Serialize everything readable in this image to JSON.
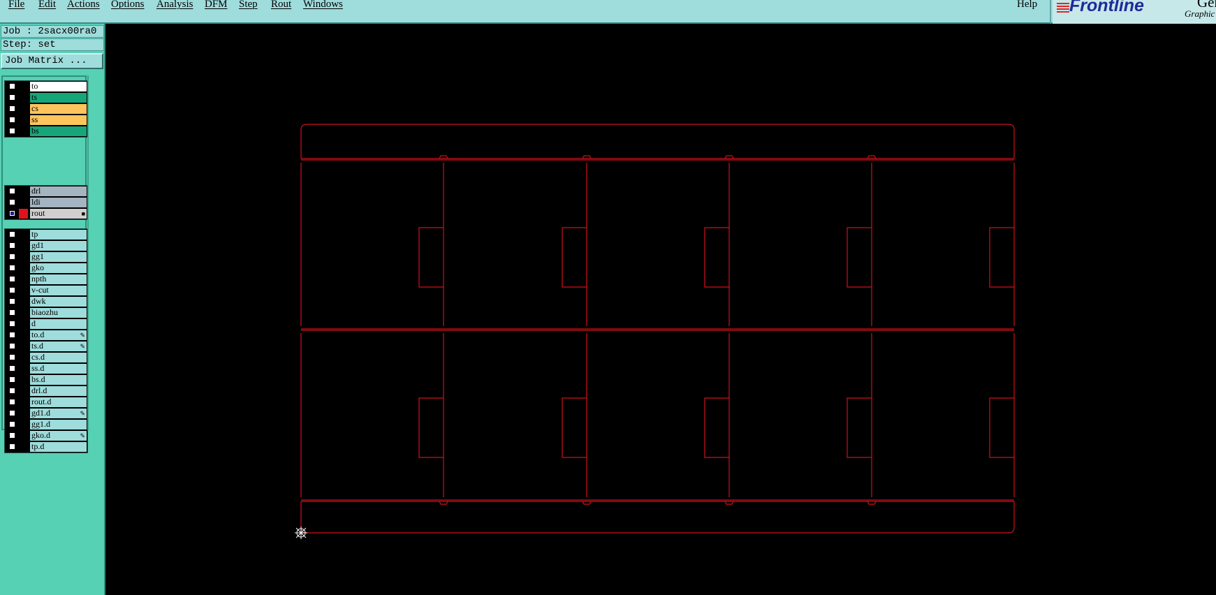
{
  "menubar": {
    "items": [
      "File",
      "Edit",
      "Actions",
      "Options",
      "Analysis",
      "DFM",
      "Step",
      "Rout",
      "Windows"
    ],
    "help": "Help"
  },
  "logo": {
    "name": "Frontline",
    "line1": "Gene",
    "line2": "Graphic"
  },
  "job": {
    "label": "Job : 2sacx00ra0"
  },
  "step": {
    "label": "Step: set"
  },
  "job_matrix_button": "Job Matrix ...",
  "layer_groups": [
    [
      {
        "name": "to",
        "bg": "#ffffff",
        "color": "#000000",
        "checked": false,
        "mark": ""
      },
      {
        "name": "ts",
        "bg": "#17a57a",
        "color": "#000000",
        "checked": false,
        "mark": ""
      },
      {
        "name": "cs",
        "bg": "#ffc45c",
        "color": "#000000",
        "checked": false,
        "mark": ""
      },
      {
        "name": "ss",
        "bg": "#ffc45c",
        "color": "#000000",
        "checked": false,
        "mark": ""
      },
      {
        "name": "bs",
        "bg": "#17a57a",
        "color": "#000000",
        "checked": false,
        "mark": ""
      }
    ],
    [
      {
        "name": "drl",
        "bg": "#a4b4c0",
        "color": "#000000",
        "checked": false,
        "mark": ""
      },
      {
        "name": "ldi",
        "bg": "#a4b4c0",
        "color": "#000000",
        "checked": false,
        "mark": ""
      },
      {
        "name": "rout",
        "bg": "#d0d0d0",
        "color": "#e0121c",
        "checked": true,
        "mark": "■"
      }
    ],
    [
      {
        "name": "tp",
        "bg": "#9fdcdc",
        "color": "#000000",
        "checked": false,
        "mark": ""
      },
      {
        "name": "gd1",
        "bg": "#9fdcdc",
        "color": "#000000",
        "checked": false,
        "mark": ""
      },
      {
        "name": "gg1",
        "bg": "#9fdcdc",
        "color": "#000000",
        "checked": false,
        "mark": ""
      },
      {
        "name": "gko",
        "bg": "#9fdcdc",
        "color": "#000000",
        "checked": false,
        "mark": ""
      },
      {
        "name": "npth",
        "bg": "#9fdcdc",
        "color": "#000000",
        "checked": false,
        "mark": ""
      },
      {
        "name": "v-cut",
        "bg": "#9fdcdc",
        "color": "#000000",
        "checked": false,
        "mark": ""
      },
      {
        "name": "dwk",
        "bg": "#9fdcdc",
        "color": "#000000",
        "checked": false,
        "mark": ""
      },
      {
        "name": "biaozhu",
        "bg": "#9fdcdc",
        "color": "#000000",
        "checked": false,
        "mark": ""
      },
      {
        "name": "d",
        "bg": "#9fdcdc",
        "color": "#000000",
        "checked": false,
        "mark": ""
      },
      {
        "name": "to.d",
        "bg": "#9fdcdc",
        "color": "#000000",
        "checked": false,
        "mark": "✎"
      },
      {
        "name": "ts.d",
        "bg": "#9fdcdc",
        "color": "#000000",
        "checked": false,
        "mark": "✎"
      },
      {
        "name": "cs.d",
        "bg": "#9fdcdc",
        "color": "#000000",
        "checked": false,
        "mark": ""
      },
      {
        "name": "ss.d",
        "bg": "#9fdcdc",
        "color": "#000000",
        "checked": false,
        "mark": ""
      },
      {
        "name": "bs.d",
        "bg": "#9fdcdc",
        "color": "#000000",
        "checked": false,
        "mark": ""
      },
      {
        "name": "drl.d",
        "bg": "#9fdcdc",
        "color": "#000000",
        "checked": false,
        "mark": ""
      },
      {
        "name": "rout.d",
        "bg": "#9fdcdc",
        "color": "#000000",
        "checked": false,
        "mark": ""
      },
      {
        "name": "gd1.d",
        "bg": "#9fdcdc",
        "color": "#000000",
        "checked": false,
        "mark": "✎"
      },
      {
        "name": "gg1.d",
        "bg": "#9fdcdc",
        "color": "#000000",
        "checked": false,
        "mark": ""
      },
      {
        "name": "gko.d",
        "bg": "#9fdcdc",
        "color": "#000000",
        "checked": false,
        "mark": "✎"
      },
      {
        "name": "tp.d",
        "bg": "#9fdcdc",
        "color": "#000000",
        "checked": false,
        "mark": ""
      }
    ]
  ],
  "canvas": {
    "background": "#000000",
    "line_color": "#d0101a",
    "origin_marker": "datum-icon",
    "panel_columns": 5,
    "panel_rows": 2
  }
}
